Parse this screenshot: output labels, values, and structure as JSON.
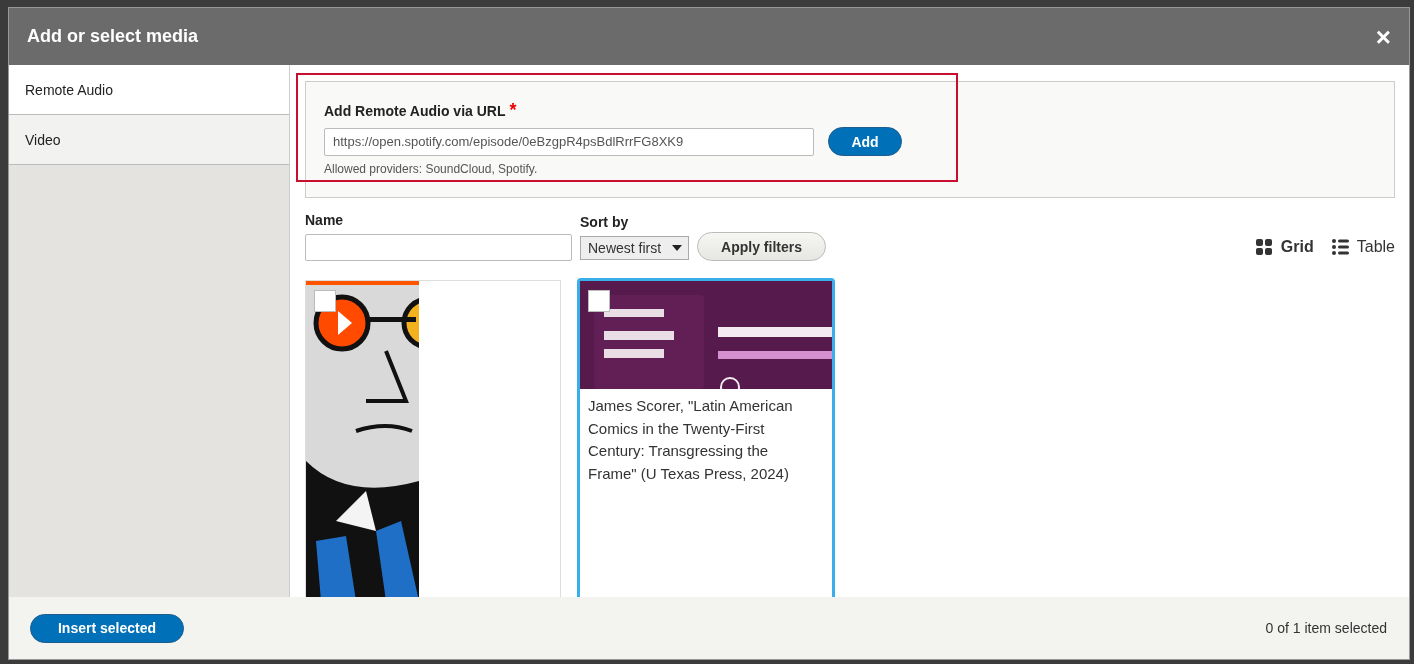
{
  "dialog": {
    "title": "Add or select media",
    "close": "×"
  },
  "tabs": [
    {
      "label": "Remote Audio",
      "selected": true
    },
    {
      "label": "Video",
      "selected": false
    }
  ],
  "add_form": {
    "label": "Add Remote Audio via URL",
    "required_mark": "*",
    "value": "https://open.spotify.com/episode/0eBzgpR4psBdlRrrFG8XK9",
    "button": "Add",
    "help": "Allowed providers: SoundCloud, Spotify.",
    "highlighted": true
  },
  "filters": {
    "name_label": "Name",
    "sort_label": "Sort by",
    "sort_value": "Newest first",
    "apply": "Apply filters"
  },
  "views": [
    {
      "label": "Grid",
      "kind": "grid",
      "selected": true
    },
    {
      "label": "Table",
      "kind": "table",
      "selected": false
    }
  ],
  "media": [
    {
      "kind": "picture",
      "checked": false,
      "selected": false
    },
    {
      "kind": "picture",
      "checked": false,
      "selected": true,
      "caption": "James Scorer, \"Latin American Comics in the Twenty-First Century: Transgressing the Frame\" (U Texas Press, 2024)"
    }
  ],
  "footer": {
    "button": "Insert selected",
    "status": "0 of 1 item selected"
  }
}
